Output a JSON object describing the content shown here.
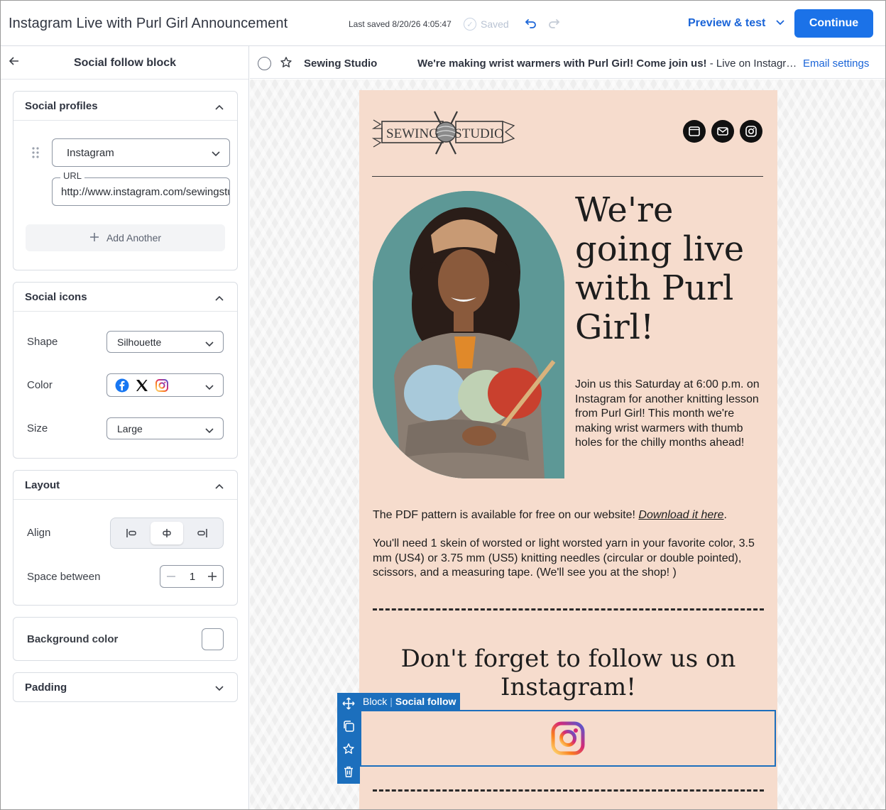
{
  "header": {
    "title": "Instagram Live with Purl Girl Announcement",
    "last_saved": "Last saved 8/20/26 4:05:47",
    "saved_label": "Saved",
    "preview_label": "Preview & test",
    "continue_label": "Continue"
  },
  "sidebar": {
    "title": "Social follow block",
    "social_profiles": {
      "title": "Social profiles",
      "network": "Instagram",
      "url_label": "URL",
      "url_value": "http://www.instagram.com/sewingstudio",
      "add_another": "Add Another"
    },
    "social_icons": {
      "title": "Social icons",
      "shape_label": "Shape",
      "shape_value": "Silhouette",
      "color_label": "Color",
      "size_label": "Size",
      "size_value": "Large"
    },
    "layout": {
      "title": "Layout",
      "align_label": "Align",
      "align_selected": "center",
      "space_label": "Space between",
      "space_value": "1"
    },
    "background": {
      "title": "Background color",
      "color": "#ffffff"
    },
    "padding": {
      "title": "Padding"
    }
  },
  "canvas": {
    "from": "Sewing Studio",
    "subject_bold": "We're making wrist warmers with Purl Girl! Come join us!",
    "subject_rest": " - Live on Instagram",
    "settings_label": "Email settings"
  },
  "email": {
    "logo_left": "SEWING",
    "logo_right": "STUDIO",
    "headline": "We're going live with Purl Girl!",
    "blurb": "Join us this Saturday at 6:00 p.m. on Instagram for another knitting lesson from Purl Girl! This month we're making wrist warmers with thumb holes for the chilly months ahead!",
    "pdf_text": "The PDF pattern is available for free on our website! ",
    "pdf_link": "Download it here",
    "pdf_end": ".",
    "supplies": "You'll need 1 skein of worsted or light worsted yarn in your favorite color, 3.5 mm (US4) or 3.75 mm (US5) knitting needles (circular or double pointed), scissors, and a measuring tape. (We'll see you at the shop! )",
    "follow_heading": "Don't forget to follow us on Instagram!",
    "background": "#f6dccd"
  },
  "selection": {
    "block_label": "Block",
    "block_type": "Social follow"
  },
  "colors": {
    "accent": "#1b72e8",
    "selection": "#1c6fbd"
  }
}
